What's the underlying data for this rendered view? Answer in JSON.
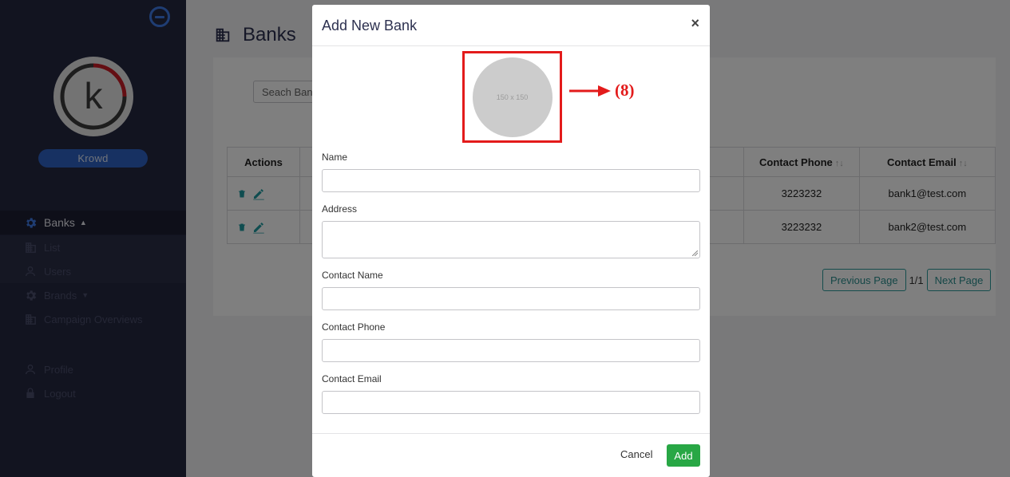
{
  "sidebar": {
    "brand_name": "Krowd",
    "logo_letter": "k",
    "nav": {
      "banks": "Banks",
      "list": "List",
      "users": "Users",
      "brands": "Brands",
      "campaign_overviews": "Campaign Overviews",
      "profile": "Profile",
      "logout": "Logout"
    }
  },
  "main": {
    "page_title": "Banks",
    "search_placeholder": "Seach Ban",
    "table": {
      "headers": {
        "actions": "Actions",
        "contact_phone": "Contact Phone",
        "contact_email": "Contact Email"
      },
      "sort_glyph": "↑↓",
      "rows": [
        {
          "contact_phone": "3223232",
          "contact_email": "bank1@test.com"
        },
        {
          "contact_phone": "3223232",
          "contact_email": "bank2@test.com"
        }
      ]
    },
    "pager": {
      "previous": "Previous Page",
      "count": "1/1",
      "next": "Next Page"
    }
  },
  "modal": {
    "title": "Add New Bank",
    "close": "×",
    "image_placeholder": "150 x 150",
    "annotation": "(8)",
    "fields": {
      "name": "Name",
      "address": "Address",
      "contact_name": "Contact Name",
      "contact_phone": "Contact Phone",
      "contact_email": "Contact Email"
    },
    "cancel": "Cancel",
    "add": "Add"
  },
  "colors": {
    "sidebar_bg": "#252841",
    "accent_blue": "#2f63c4",
    "teal": "#2a9a9a",
    "annotation_red": "#e31b1b",
    "add_green": "#28a745"
  }
}
